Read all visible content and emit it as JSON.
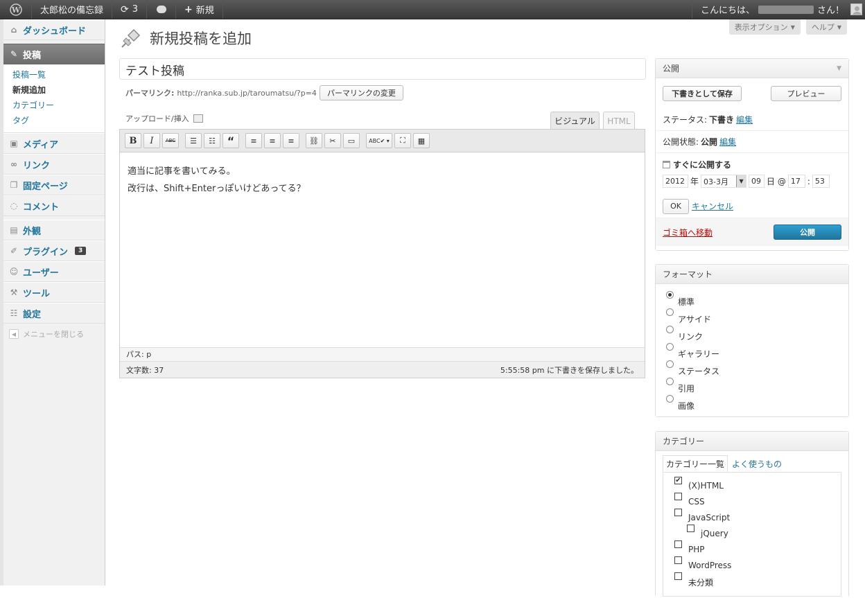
{
  "adminbar": {
    "site_name": "太郎松の備忘録",
    "updates": "3",
    "new_label": "新規",
    "greeting": "こんにちは、",
    "greeting_suffix": "さん！"
  },
  "sidebar": {
    "dashboard": "ダッシュボード",
    "posts": "投稿",
    "posts_sub": [
      "投稿一覧",
      "新規追加",
      "カテゴリー",
      "タグ"
    ],
    "media": "メディア",
    "links": "リンク",
    "pages": "固定ページ",
    "comments": "コメント",
    "appearance": "外観",
    "plugins": "プラグイン",
    "plugins_badge": "3",
    "users": "ユーザー",
    "tools": "ツール",
    "settings": "設定",
    "collapse": "メニューを閉じる"
  },
  "screen": {
    "options": "表示オプション",
    "help": "ヘルプ"
  },
  "page": {
    "title": "新規投稿を追加",
    "post_title": "テスト投稿",
    "permalink_label": "パーマリンク:",
    "permalink_url": "http://ranka.sub.jp/taroumatsu/?p=4",
    "permalink_button": "パーマリンクの変更",
    "upload_insert": "アップロード/挿入"
  },
  "editor": {
    "tab_visual": "ビジュアル",
    "tab_html": "HTML",
    "lines": [
      "適当に記事を書いてみる。",
      "改行は、Shift+Enterっぽいけどあってる？"
    ],
    "path": "パス: p",
    "word_count": "文字数: 37",
    "saved": "5:55:58 pm に下書きを保存しました。",
    "toolbar": [
      "B",
      "I",
      "ABC",
      "ul",
      "ol",
      "“",
      "al",
      "ac",
      "ar",
      "link",
      "unlink",
      "more",
      "ABC✔",
      "full",
      "kitchen"
    ]
  },
  "publish": {
    "title": "公開",
    "save_draft": "下書きとして保存",
    "preview": "プレビュー",
    "status_label": "ステータス:",
    "status_value": "下書き",
    "edit": "編集",
    "visibility_label": "公開状態:",
    "visibility_value": "公開",
    "schedule": "すぐに公開する",
    "year": "2012",
    "year_suffix": "年",
    "month": "03-3月",
    "day": "09",
    "day_suffix": "日 @",
    "hour": "17",
    "colon": ":",
    "minute": "53",
    "ok": "OK",
    "cancel": "キャンセル",
    "trash": "ゴミ箱へ移動",
    "publish": "公開"
  },
  "format": {
    "title": "フォーマット",
    "options": [
      "標準",
      "アサイド",
      "リンク",
      "ギャラリー",
      "ステータス",
      "引用",
      "画像"
    ],
    "selected": 0
  },
  "categories": {
    "title": "カテゴリー",
    "tab_all": "カテゴリー一覧",
    "tab_popular": "よく使うもの",
    "items": [
      {
        "label": "(X)HTML",
        "checked": true
      },
      {
        "label": "CSS"
      },
      {
        "label": "JavaScript"
      },
      {
        "label": "jQuery",
        "child": true
      },
      {
        "label": "PHP"
      },
      {
        "label": "WordPress"
      },
      {
        "label": "未分類"
      }
    ]
  }
}
